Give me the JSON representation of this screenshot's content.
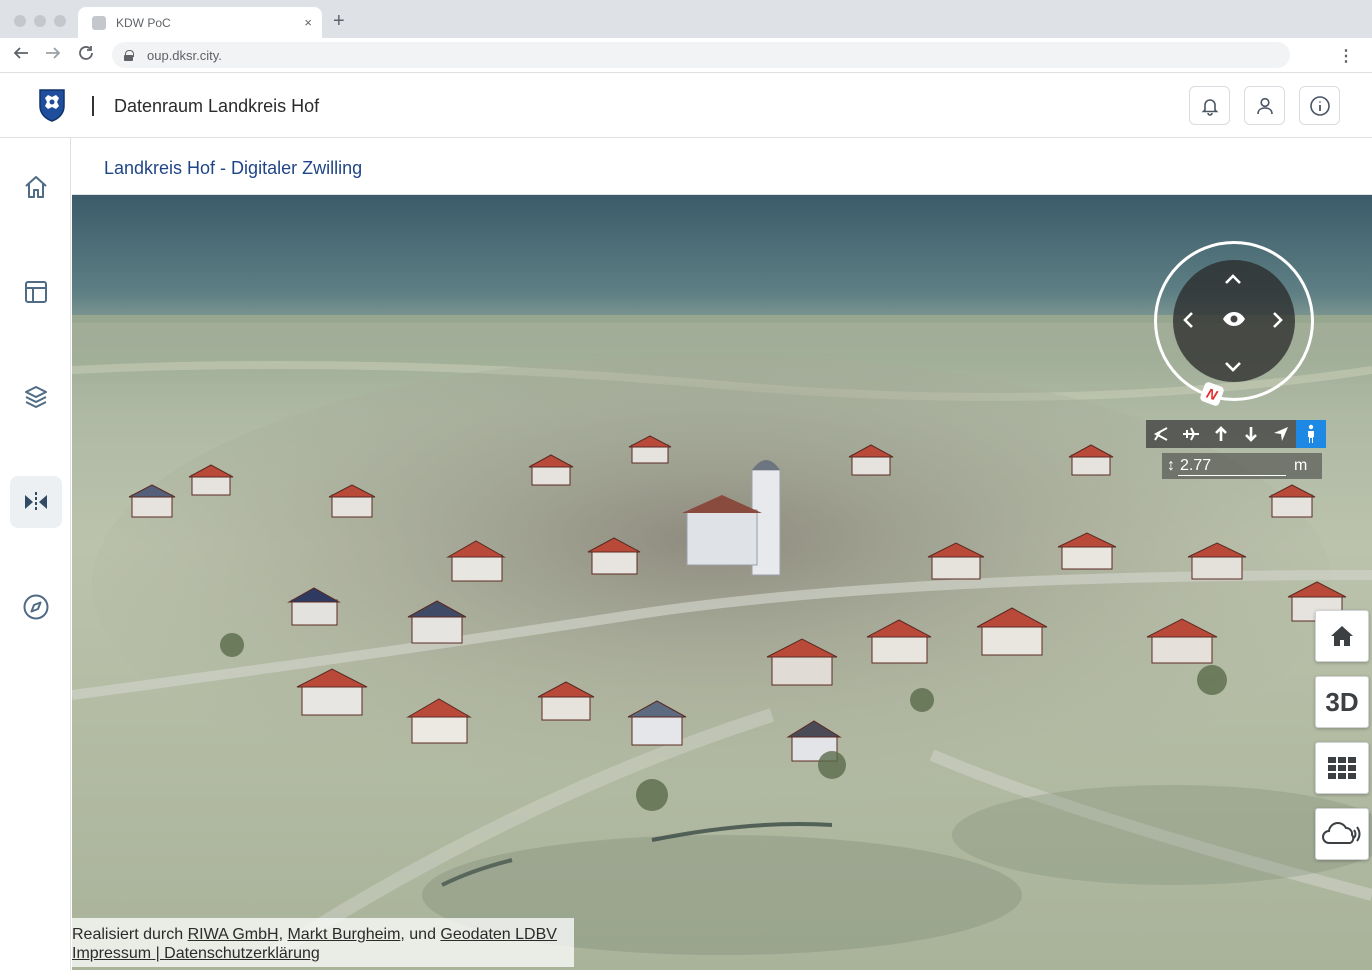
{
  "browser": {
    "tab_title": "KDW PoC",
    "tab_close": "×",
    "new_tab": "+",
    "url": "oup.dksr.city.",
    "back_icon": "arrow-left-icon",
    "forward_icon": "arrow-right-icon",
    "reload_icon": "reload-icon",
    "menu_icon": "kebab-icon"
  },
  "header": {
    "title": "Datenraum Landkreis Hof",
    "buttons": [
      "bell-icon",
      "user-icon",
      "info-icon"
    ]
  },
  "sidebar": {
    "items": [
      {
        "icon": "home-icon"
      },
      {
        "icon": "layout-icon"
      },
      {
        "icon": "layers-icon"
      },
      {
        "icon": "digital-twin-icon",
        "active": true
      },
      {
        "icon": "compass-icon"
      }
    ]
  },
  "page": {
    "title": "Landkreis Hof - Digitaler Zwilling"
  },
  "viewer": {
    "compass": {
      "north_label": "N",
      "up": "⌃",
      "down": "⌄",
      "left": "‹",
      "right": "›"
    },
    "modes": [
      "hide-icon",
      "fly-icon",
      "up-icon",
      "down-icon",
      "locate-icon",
      "pedestrian-icon"
    ],
    "height": {
      "value": "2.77",
      "unit": "m"
    },
    "side_buttons": {
      "home_icon": "home-icon",
      "toggle_label": "3D",
      "grid_icon": "grid-icon",
      "cloud_icon": "cloud-icon"
    },
    "colors": {
      "active_mode": "#1e88e5",
      "title": "#1f4587"
    }
  },
  "footer": {
    "prefix": "Realisiert durch ",
    "link1": "RIWA GmbH",
    "comma": ", ",
    "link2": "Markt Burgheim",
    "und": ", und ",
    "link3": "Geodaten LDBV",
    "impressum": "Impressum",
    "divider": " | ",
    "privacy": "Datenschutzerklärung"
  }
}
